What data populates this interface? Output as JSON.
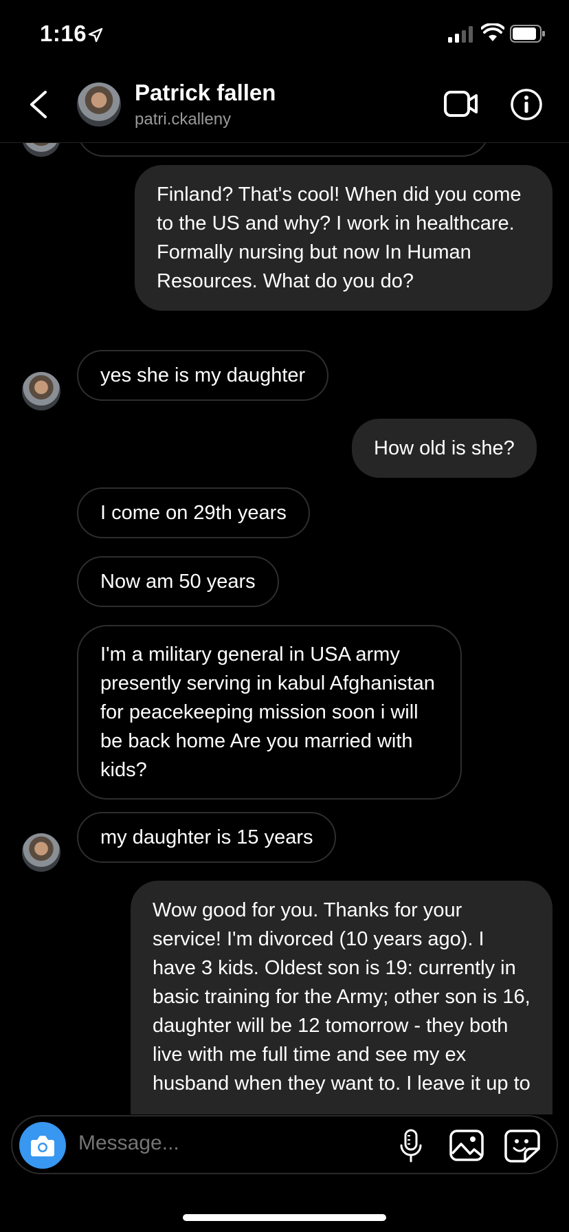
{
  "status_bar": {
    "time": "1:16"
  },
  "header": {
    "name": "Patrick fallen",
    "handle": "patri.ckalleny"
  },
  "messages": [
    {
      "side": "out",
      "text": "Finland? That's cool! When did you come to the US and why? I work in healthcare. Formally nursing but now In Human Resources. What do you do?"
    },
    {
      "side": "in",
      "text": "yes she is my daughter"
    },
    {
      "side": "out",
      "text": "How old is she?"
    },
    {
      "side": "in",
      "text": "I come on 29th years"
    },
    {
      "side": "in",
      "text": "Now am 50 years"
    },
    {
      "side": "in",
      "text": "I'm a military general in USA army presently serving in kabul Afghanistan for peacekeeping mission soon i will be back home Are you married with kids?"
    },
    {
      "side": "in",
      "text": "my daughter is 15 years"
    },
    {
      "side": "out",
      "text": "Wow good for you. Thanks for your service! I'm divorced (10 years ago). I have 3 kids. Oldest son is 19: currently in basic training for the Army; other son is 16, daughter will be 12 tomorrow - they both live with me full time and see my ex husband when they want to. I leave it up to"
    }
  ],
  "composer": {
    "placeholder": "Message..."
  }
}
